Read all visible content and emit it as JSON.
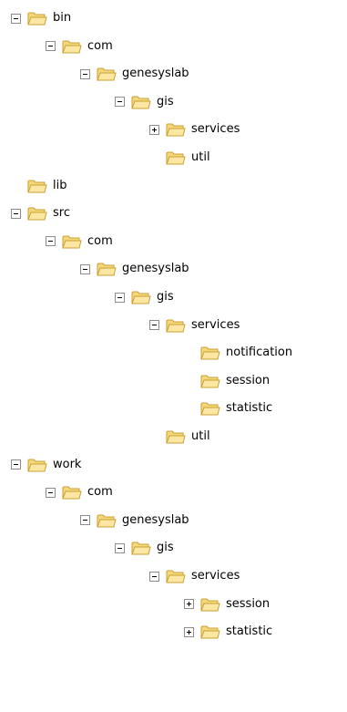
{
  "tree": [
    {
      "label": "bin",
      "level": 0,
      "toggle": "minus"
    },
    {
      "label": "com",
      "level": 1,
      "toggle": "minus"
    },
    {
      "label": "genesyslab",
      "level": 2,
      "toggle": "minus"
    },
    {
      "label": "gis",
      "level": 3,
      "toggle": "minus"
    },
    {
      "label": "services",
      "level": 4,
      "toggle": "plus"
    },
    {
      "label": "util",
      "level": 4,
      "toggle": "none"
    },
    {
      "label": "lib",
      "level": 0,
      "toggle": "none"
    },
    {
      "label": "src",
      "level": 0,
      "toggle": "minus"
    },
    {
      "label": "com",
      "level": 1,
      "toggle": "minus"
    },
    {
      "label": "genesyslab",
      "level": 2,
      "toggle": "minus"
    },
    {
      "label": "gis",
      "level": 3,
      "toggle": "minus"
    },
    {
      "label": "services",
      "level": 4,
      "toggle": "minus"
    },
    {
      "label": "notification",
      "level": 5,
      "toggle": "none"
    },
    {
      "label": "session",
      "level": 5,
      "toggle": "none"
    },
    {
      "label": "statistic",
      "level": 5,
      "toggle": "none"
    },
    {
      "label": "util",
      "level": 4,
      "toggle": "none"
    },
    {
      "label": "work",
      "level": 0,
      "toggle": "minus"
    },
    {
      "label": "com",
      "level": 1,
      "toggle": "minus"
    },
    {
      "label": "genesyslab",
      "level": 2,
      "toggle": "minus"
    },
    {
      "label": "gis",
      "level": 3,
      "toggle": "minus"
    },
    {
      "label": "services",
      "level": 4,
      "toggle": "minus"
    },
    {
      "label": "session",
      "level": 5,
      "toggle": "plus"
    },
    {
      "label": "statistic",
      "level": 5,
      "toggle": "plus"
    }
  ],
  "icons": {
    "folder": "folder-icon",
    "expand": "plus-box-icon",
    "collapse": "minus-box-icon"
  },
  "colors": {
    "folder_fill": "#f4d77a",
    "folder_dark": "#c9a032",
    "folder_front": "#fbe7a3"
  }
}
